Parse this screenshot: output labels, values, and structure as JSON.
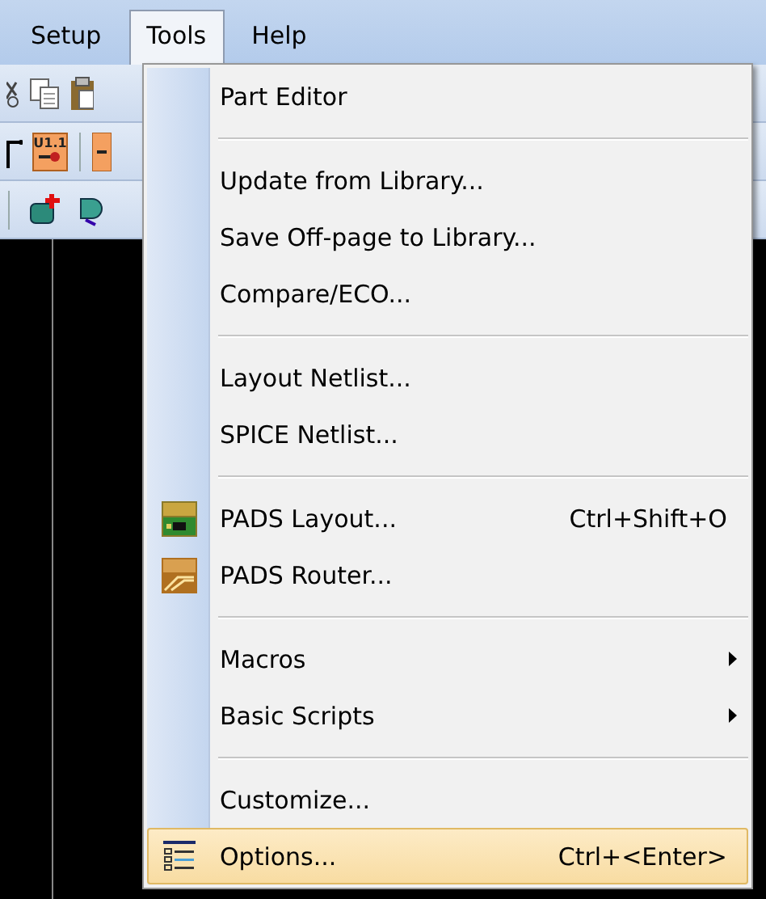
{
  "menubar": [
    {
      "label": "Setup",
      "selected": false
    },
    {
      "label": "Tools",
      "selected": true
    },
    {
      "label": "Help",
      "selected": false
    }
  ],
  "toolbar": {
    "badge": "U1.1"
  },
  "menu": {
    "items": [
      {
        "kind": "item",
        "label": "Part Editor",
        "submenu": false,
        "selected": false
      },
      {
        "kind": "separator"
      },
      {
        "kind": "item",
        "label": "Update from Library...",
        "submenu": false,
        "selected": false
      },
      {
        "kind": "item",
        "label": "Save Off-page to Library...",
        "submenu": false,
        "selected": false
      },
      {
        "kind": "item",
        "label": "Compare/ECO...",
        "submenu": false,
        "selected": false
      },
      {
        "kind": "separator"
      },
      {
        "kind": "item",
        "label": "Layout Netlist...",
        "submenu": false,
        "selected": false
      },
      {
        "kind": "item",
        "label": "SPICE Netlist...",
        "submenu": false,
        "selected": false
      },
      {
        "kind": "separator"
      },
      {
        "kind": "item",
        "label": "PADS Layout...",
        "shortcut": "Ctrl+Shift+O",
        "submenu": false,
        "selected": false
      },
      {
        "kind": "item",
        "label": "PADS Router...",
        "submenu": false,
        "selected": false
      },
      {
        "kind": "separator"
      },
      {
        "kind": "item",
        "label": "Macros",
        "submenu": true,
        "selected": false
      },
      {
        "kind": "item",
        "label": "Basic Scripts",
        "submenu": true,
        "selected": false
      },
      {
        "kind": "separator"
      },
      {
        "kind": "item",
        "label": "Customize...",
        "submenu": false,
        "selected": false
      },
      {
        "kind": "item",
        "label": "Options...",
        "shortcut": "Ctrl+<Enter>",
        "submenu": false,
        "selected": true
      }
    ]
  }
}
